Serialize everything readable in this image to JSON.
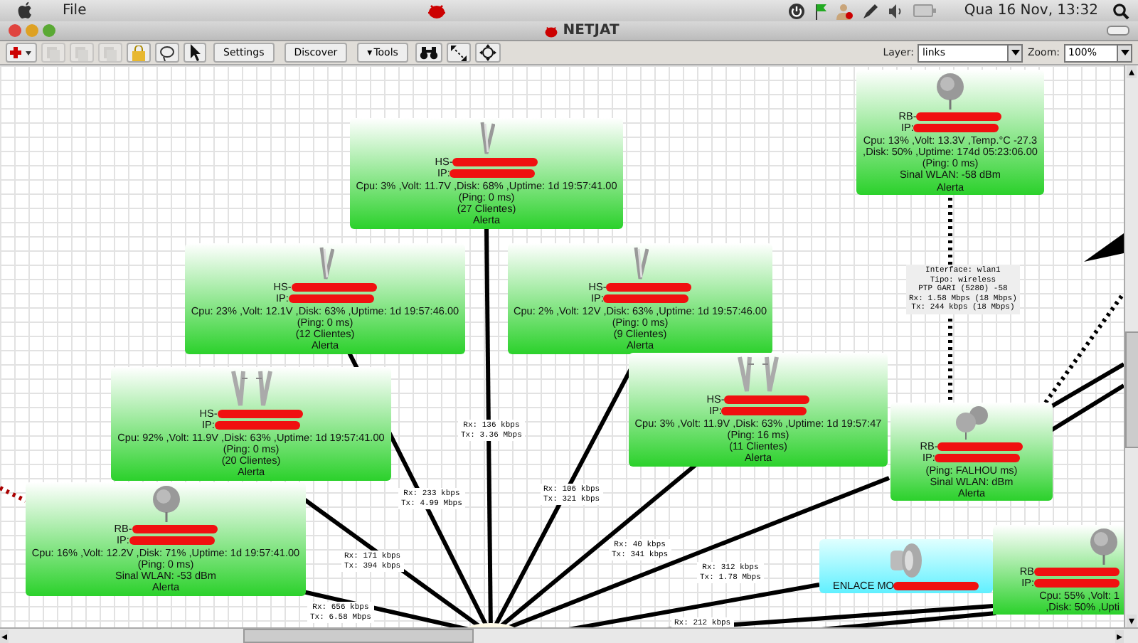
{
  "menubar": {
    "menu": "File",
    "clock": "Qua 16 Nov, 13:32"
  },
  "window": {
    "title": "NETJAT"
  },
  "toolbar": {
    "tools": [
      {
        "kind": "add",
        "disabled": false
      },
      {
        "kind": "cut",
        "disabled": true
      },
      {
        "kind": "copy",
        "disabled": true
      },
      {
        "kind": "paste",
        "disabled": true
      },
      {
        "kind": "lock",
        "disabled": false
      },
      {
        "kind": "lasso",
        "disabled": false
      },
      {
        "kind": "pointer",
        "disabled": false
      }
    ],
    "buttons": [
      {
        "label": "Settings"
      },
      {
        "label": "Discover"
      },
      {
        "label": "Tools",
        "caret": "▾"
      }
    ],
    "view_tools": [
      {
        "kind": "binoculars"
      },
      {
        "kind": "fit"
      },
      {
        "kind": "center"
      }
    ],
    "layer": {
      "label": "Layer:",
      "value": "links"
    },
    "zoom": {
      "label": "Zoom:",
      "value": "100%"
    }
  },
  "nodes": [
    {
      "kind": "sector",
      "lines": [
        {
          "text": "HS-",
          "redacted": true
        },
        {
          "text": "IP:",
          "redacted": true
        },
        {
          "text": "Cpu: 3% ,Volt: 11.7V ,Disk: 68% ,Uptime: 1d 19:57:41.00"
        },
        {
          "text": "(Ping: 0 ms)"
        },
        {
          "text": "(27 Clientes)"
        },
        {
          "text": "Alerta"
        }
      ]
    },
    {
      "kind": "dish",
      "lines": [
        {
          "text": "RB-",
          "redacted": true
        },
        {
          "text": "IP:",
          "redacted": true
        },
        {
          "text": "Cpu: 13% ,Volt: 13.3V ,Temp.°C -27.3"
        },
        {
          "text": ",Disk: 50% ,Uptime: 174d 05:23:06.00"
        },
        {
          "text": "(Ping: 0 ms)"
        },
        {
          "text": "Sinal WLAN: -58 dBm"
        },
        {
          "text": "Alerta"
        }
      ]
    },
    {
      "kind": "sector",
      "lines": [
        {
          "text": "HS-",
          "redacted": true
        },
        {
          "text": "IP:",
          "redacted": true
        },
        {
          "text": "Cpu: 23% ,Volt: 12.1V ,Disk: 63% ,Uptime: 1d 19:57:46.00"
        },
        {
          "text": "(Ping: 0 ms)"
        },
        {
          "text": "(12 Clientes)"
        },
        {
          "text": "Alerta"
        }
      ]
    },
    {
      "kind": "sector",
      "lines": [
        {
          "text": "HS-",
          "redacted": true
        },
        {
          "text": "IP:",
          "redacted": true
        },
        {
          "text": "Cpu: 2% ,Volt: 12V ,Disk: 63% ,Uptime: 1d 19:57:46.00"
        },
        {
          "text": "(Ping: 0 ms)"
        },
        {
          "text": "(9 Clientes)"
        },
        {
          "text": "Alerta"
        }
      ]
    },
    {
      "kind": "dual-sector",
      "lines": [
        {
          "text": "HS-",
          "redacted": true
        },
        {
          "text": "IP:",
          "redacted": true
        },
        {
          "text": "Cpu: 92% ,Volt: 11.9V ,Disk: 63% ,Uptime: 1d 19:57:41.00"
        },
        {
          "text": "(Ping: 0 ms)"
        },
        {
          "text": "(20 Clientes)"
        },
        {
          "text": "Alerta"
        }
      ]
    },
    {
      "kind": "dish",
      "lines": [
        {
          "text": "RB-",
          "redacted": true
        },
        {
          "text": "IP:",
          "redacted": true
        },
        {
          "text": "Cpu: 16% ,Volt: 12.2V ,Disk: 71% ,Uptime: 1d 19:57:41.00"
        },
        {
          "text": "(Ping: 0 ms)"
        },
        {
          "text": "Sinal WLAN: -53 dBm"
        },
        {
          "text": "Alerta"
        }
      ]
    },
    {
      "kind": "dual-sector",
      "lines": [
        {
          "text": "HS-",
          "redacted": true
        },
        {
          "text": "IP:",
          "redacted": true
        },
        {
          "text": "Cpu: 3% ,Volt: 11.9V ,Disk: 63% ,Uptime: 1d 19:57:47"
        },
        {
          "text": "(Ping: 16 ms)"
        },
        {
          "text": "(11 Clientes)"
        },
        {
          "text": "Alerta"
        }
      ]
    },
    {
      "kind": "dual-dish",
      "lines": [
        {
          "text": "RB-",
          "redacted": true
        },
        {
          "text": "IP:",
          "redacted": true
        },
        {
          "text": "(Ping: FALHOU ms)"
        },
        {
          "text": "Sinal WLAN:  dBm"
        },
        {
          "text": "Alerta"
        }
      ]
    },
    {
      "kind": "link-dish",
      "lines": [
        {
          "text": "ENLACE MO",
          "redacted": true
        }
      ]
    },
    {
      "kind": "dish",
      "lines": [
        {
          "text": "RB",
          "redacted": true
        },
        {
          "text": "IP:",
          "redacted": true
        },
        {
          "text": "Cpu: 55% ,Volt: 1"
        },
        {
          "text": ",Disk: 50% ,Upti"
        }
      ]
    }
  ],
  "link_labels": [
    {
      "lines": [
        "Rx: 136 kbps",
        "Tx: 3.36 Mbps"
      ]
    },
    {
      "lines": [
        "Rx: 233 kbps",
        "Tx: 4.99 Mbps"
      ]
    },
    {
      "lines": [
        "Rx: 106 kbps",
        "Tx: 321 kbps"
      ]
    },
    {
      "lines": [
        "Rx: 171 kbps",
        "Tx: 394 kbps"
      ]
    },
    {
      "lines": [
        "Rx: 40 kbps",
        "Tx: 341 kbps"
      ]
    },
    {
      "lines": [
        "Rx: 312 kbps",
        "Tx: 1.78 Mbps"
      ]
    },
    {
      "lines": [
        "Rx: 656 kbps",
        "Tx: 6.58 Mbps"
      ]
    },
    {
      "lines": [
        "Rx: 212 kbps"
      ]
    }
  ],
  "scrollbars": {
    "up": "▴",
    "down": "▾",
    "left": "◂",
    "right": "▸"
  },
  "interface_info": {
    "lines": [
      "Interface: wlan1",
      "Tipo: wireless",
      "PTP GARI (5280) -58",
      "Rx: 1.58 Mbps (18 Mbps)",
      "Tx: 244 kbps (18 Mbps)"
    ]
  }
}
